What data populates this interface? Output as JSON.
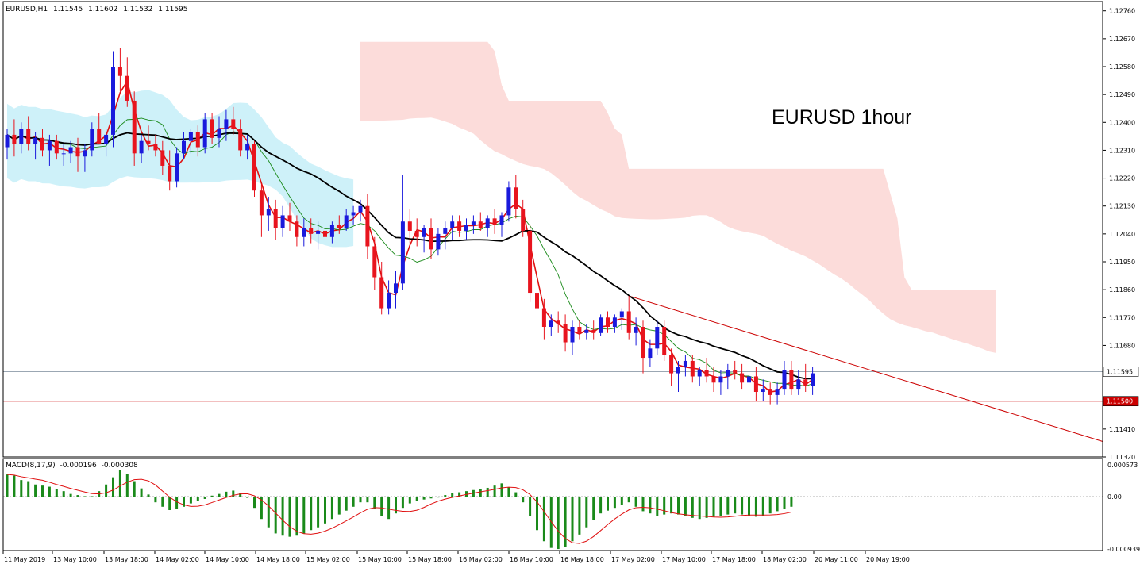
{
  "header": {
    "symbol": "EURUSD,H1",
    "open": "1.11545",
    "high": "1.11602",
    "low": "1.11532",
    "close": "1.11595"
  },
  "annotation": "EURUSD 1hour",
  "macd_header": {
    "name": "MACD(8,17,9)",
    "main": "-0.000196",
    "signal": "-0.000308"
  },
  "colors": {
    "bull": "#1a1adc",
    "bear": "#e8141e",
    "kumo_bull": "#c9f0f8",
    "kumo_bear": "#fbd6d4",
    "ma_fast": "#e01010",
    "ma_mid": "#1a8a1a",
    "ma_slow": "#000000",
    "macd_hist": "#1a8a1a",
    "macd_signal": "#e01010",
    "level": "#cc0000",
    "trend": "#cc0000"
  },
  "chart_data": [
    {
      "type": "candlestick",
      "symbol": "EURUSD",
      "timeframe": "H1",
      "title": "EURUSD 1hour",
      "ylim": [
        1.1132,
        1.1279
      ],
      "y_ticks": [
        "1.12760",
        "1.12670",
        "1.12580",
        "1.12490",
        "1.12400",
        "1.12310",
        "1.12220",
        "1.12130",
        "1.12040",
        "1.11950",
        "1.11860",
        "1.11770",
        "1.11680",
        "1.11410",
        "1.11320"
      ],
      "x_ticks": [
        "11 May 2019",
        "13 May 10:00",
        "13 May 18:00",
        "14 May 02:00",
        "14 May 10:00",
        "14 May 18:00",
        "15 May 02:00",
        "15 May 10:00",
        "15 May 18:00",
        "16 May 02:00",
        "16 May 10:00",
        "16 May 18:00",
        "17 May 02:00",
        "17 May 10:00",
        "17 May 18:00",
        "18 May 02:00",
        "20 May 11:00",
        "20 May 19:00"
      ],
      "current_price": {
        "value": 1.11595,
        "label": "1.11595"
      },
      "horizontal_level": {
        "value": 1.115,
        "label": "1.11500"
      },
      "trendline": {
        "from": {
          "bar": 88,
          "price": 1.1184
        },
        "to_price_at_right_edge": 1.1137
      },
      "candles": [
        {
          "o": 1.1232,
          "h": 1.1238,
          "l": 1.1228,
          "c": 1.1236
        },
        {
          "o": 1.1236,
          "h": 1.1241,
          "l": 1.1229,
          "c": 1.1233
        },
        {
          "o": 1.1233,
          "h": 1.124,
          "l": 1.123,
          "c": 1.1238
        },
        {
          "o": 1.1238,
          "h": 1.1242,
          "l": 1.1231,
          "c": 1.1233
        },
        {
          "o": 1.1233,
          "h": 1.1237,
          "l": 1.1228,
          "c": 1.1235
        },
        {
          "o": 1.1235,
          "h": 1.1238,
          "l": 1.1229,
          "c": 1.1231
        },
        {
          "o": 1.1231,
          "h": 1.1236,
          "l": 1.1226,
          "c": 1.1234
        },
        {
          "o": 1.1234,
          "h": 1.1236,
          "l": 1.1228,
          "c": 1.123
        },
        {
          "o": 1.123,
          "h": 1.1233,
          "l": 1.1226,
          "c": 1.123
        },
        {
          "o": 1.123,
          "h": 1.1234,
          "l": 1.1227,
          "c": 1.1232
        },
        {
          "o": 1.1232,
          "h": 1.1235,
          "l": 1.1224,
          "c": 1.1229
        },
        {
          "o": 1.1229,
          "h": 1.1233,
          "l": 1.1224,
          "c": 1.1231
        },
        {
          "o": 1.1231,
          "h": 1.124,
          "l": 1.1229,
          "c": 1.1238
        },
        {
          "o": 1.1238,
          "h": 1.1243,
          "l": 1.1233,
          "c": 1.1233
        },
        {
          "o": 1.1233,
          "h": 1.1238,
          "l": 1.1229,
          "c": 1.1236
        },
        {
          "o": 1.1236,
          "h": 1.1263,
          "l": 1.1232,
          "c": 1.1258
        },
        {
          "o": 1.1258,
          "h": 1.1264,
          "l": 1.125,
          "c": 1.1255
        },
        {
          "o": 1.1255,
          "h": 1.1261,
          "l": 1.1245,
          "c": 1.1247
        },
        {
          "o": 1.1247,
          "h": 1.125,
          "l": 1.1226,
          "c": 1.123
        },
        {
          "o": 1.123,
          "h": 1.1236,
          "l": 1.1227,
          "c": 1.1234
        },
        {
          "o": 1.1234,
          "h": 1.1239,
          "l": 1.1231,
          "c": 1.1233
        },
        {
          "o": 1.1233,
          "h": 1.1236,
          "l": 1.1229,
          "c": 1.1231
        },
        {
          "o": 1.1231,
          "h": 1.1234,
          "l": 1.1223,
          "c": 1.1226
        },
        {
          "o": 1.1226,
          "h": 1.1231,
          "l": 1.1218,
          "c": 1.1221
        },
        {
          "o": 1.1221,
          "h": 1.1232,
          "l": 1.1219,
          "c": 1.123
        },
        {
          "o": 1.123,
          "h": 1.1237,
          "l": 1.1228,
          "c": 1.1234
        },
        {
          "o": 1.1234,
          "h": 1.1238,
          "l": 1.123,
          "c": 1.1237
        },
        {
          "o": 1.1237,
          "h": 1.1239,
          "l": 1.1229,
          "c": 1.1232
        },
        {
          "o": 1.1232,
          "h": 1.1243,
          "l": 1.123,
          "c": 1.1241
        },
        {
          "o": 1.1241,
          "h": 1.1243,
          "l": 1.1233,
          "c": 1.1235
        },
        {
          "o": 1.1235,
          "h": 1.1242,
          "l": 1.1232,
          "c": 1.1238
        },
        {
          "o": 1.1238,
          "h": 1.1244,
          "l": 1.1234,
          "c": 1.1241
        },
        {
          "o": 1.1241,
          "h": 1.1245,
          "l": 1.1236,
          "c": 1.1238
        },
        {
          "o": 1.1238,
          "h": 1.1241,
          "l": 1.1229,
          "c": 1.1231
        },
        {
          "o": 1.1231,
          "h": 1.1236,
          "l": 1.1228,
          "c": 1.1233
        },
        {
          "o": 1.1233,
          "h": 1.1234,
          "l": 1.1216,
          "c": 1.1218
        },
        {
          "o": 1.1218,
          "h": 1.122,
          "l": 1.1203,
          "c": 1.121
        },
        {
          "o": 1.121,
          "h": 1.1216,
          "l": 1.1205,
          "c": 1.1212
        },
        {
          "o": 1.1212,
          "h": 1.1215,
          "l": 1.1202,
          "c": 1.1206
        },
        {
          "o": 1.1206,
          "h": 1.1213,
          "l": 1.1203,
          "c": 1.121
        },
        {
          "o": 1.121,
          "h": 1.1214,
          "l": 1.1205,
          "c": 1.1208
        },
        {
          "o": 1.1208,
          "h": 1.121,
          "l": 1.12,
          "c": 1.1203
        },
        {
          "o": 1.1203,
          "h": 1.1209,
          "l": 1.12,
          "c": 1.1206
        },
        {
          "o": 1.1206,
          "h": 1.1209,
          "l": 1.1201,
          "c": 1.1204
        },
        {
          "o": 1.1204,
          "h": 1.1208,
          "l": 1.1199,
          "c": 1.1205
        },
        {
          "o": 1.1205,
          "h": 1.1208,
          "l": 1.1201,
          "c": 1.1203
        },
        {
          "o": 1.1203,
          "h": 1.1208,
          "l": 1.1201,
          "c": 1.1207
        },
        {
          "o": 1.1207,
          "h": 1.121,
          "l": 1.1204,
          "c": 1.1206
        },
        {
          "o": 1.1206,
          "h": 1.1212,
          "l": 1.1205,
          "c": 1.121
        },
        {
          "o": 1.121,
          "h": 1.1213,
          "l": 1.1207,
          "c": 1.1211
        },
        {
          "o": 1.1211,
          "h": 1.1215,
          "l": 1.1208,
          "c": 1.1213
        },
        {
          "o": 1.1213,
          "h": 1.1217,
          "l": 1.1196,
          "c": 1.12
        },
        {
          "o": 1.12,
          "h": 1.1203,
          "l": 1.1186,
          "c": 1.119
        },
        {
          "o": 1.119,
          "h": 1.1195,
          "l": 1.1178,
          "c": 1.118
        },
        {
          "o": 1.118,
          "h": 1.1189,
          "l": 1.1178,
          "c": 1.1185
        },
        {
          "o": 1.1185,
          "h": 1.1192,
          "l": 1.118,
          "c": 1.1188
        },
        {
          "o": 1.1188,
          "h": 1.1223,
          "l": 1.1186,
          "c": 1.1208
        },
        {
          "o": 1.1208,
          "h": 1.1212,
          "l": 1.1201,
          "c": 1.1205
        },
        {
          "o": 1.1205,
          "h": 1.1209,
          "l": 1.12,
          "c": 1.1203
        },
        {
          "o": 1.1203,
          "h": 1.1207,
          "l": 1.1198,
          "c": 1.1206
        },
        {
          "o": 1.1206,
          "h": 1.1209,
          "l": 1.1196,
          "c": 1.1199
        },
        {
          "o": 1.1199,
          "h": 1.1206,
          "l": 1.1197,
          "c": 1.1204
        },
        {
          "o": 1.1204,
          "h": 1.1208,
          "l": 1.1199,
          "c": 1.1206
        },
        {
          "o": 1.1206,
          "h": 1.121,
          "l": 1.1202,
          "c": 1.1208
        },
        {
          "o": 1.1208,
          "h": 1.121,
          "l": 1.1203,
          "c": 1.1205
        },
        {
          "o": 1.1205,
          "h": 1.1209,
          "l": 1.1202,
          "c": 1.1207
        },
        {
          "o": 1.1207,
          "h": 1.121,
          "l": 1.1204,
          "c": 1.1208
        },
        {
          "o": 1.1208,
          "h": 1.1211,
          "l": 1.1205,
          "c": 1.1206
        },
        {
          "o": 1.1206,
          "h": 1.121,
          "l": 1.1203,
          "c": 1.1209
        },
        {
          "o": 1.1209,
          "h": 1.1212,
          "l": 1.1204,
          "c": 1.1207
        },
        {
          "o": 1.1207,
          "h": 1.1211,
          "l": 1.1203,
          "c": 1.121
        },
        {
          "o": 1.121,
          "h": 1.1221,
          "l": 1.1208,
          "c": 1.1219
        },
        {
          "o": 1.1219,
          "h": 1.1223,
          "l": 1.1209,
          "c": 1.1212
        },
        {
          "o": 1.1212,
          "h": 1.1215,
          "l": 1.1203,
          "c": 1.1205
        },
        {
          "o": 1.1205,
          "h": 1.1207,
          "l": 1.1182,
          "c": 1.1185
        },
        {
          "o": 1.1185,
          "h": 1.1188,
          "l": 1.1175,
          "c": 1.118
        },
        {
          "o": 1.118,
          "h": 1.1183,
          "l": 1.117,
          "c": 1.1174
        },
        {
          "o": 1.1174,
          "h": 1.1178,
          "l": 1.1171,
          "c": 1.1176
        },
        {
          "o": 1.1176,
          "h": 1.1179,
          "l": 1.1172,
          "c": 1.1175
        },
        {
          "o": 1.1175,
          "h": 1.1178,
          "l": 1.1166,
          "c": 1.1169
        },
        {
          "o": 1.1169,
          "h": 1.1176,
          "l": 1.1165,
          "c": 1.1174
        },
        {
          "o": 1.1174,
          "h": 1.1176,
          "l": 1.117,
          "c": 1.1172
        },
        {
          "o": 1.1172,
          "h": 1.1175,
          "l": 1.117,
          "c": 1.1173
        },
        {
          "o": 1.1173,
          "h": 1.1176,
          "l": 1.117,
          "c": 1.1172
        },
        {
          "o": 1.1172,
          "h": 1.1178,
          "l": 1.1171,
          "c": 1.1177
        },
        {
          "o": 1.1177,
          "h": 1.1179,
          "l": 1.1172,
          "c": 1.1174
        },
        {
          "o": 1.1174,
          "h": 1.1178,
          "l": 1.1172,
          "c": 1.1177
        },
        {
          "o": 1.1177,
          "h": 1.118,
          "l": 1.1173,
          "c": 1.1179
        },
        {
          "o": 1.1179,
          "h": 1.1184,
          "l": 1.117,
          "c": 1.1172
        },
        {
          "o": 1.1172,
          "h": 1.1177,
          "l": 1.1168,
          "c": 1.1174
        },
        {
          "o": 1.1174,
          "h": 1.1176,
          "l": 1.1159,
          "c": 1.1164
        },
        {
          "o": 1.1164,
          "h": 1.117,
          "l": 1.1161,
          "c": 1.1167
        },
        {
          "o": 1.1167,
          "h": 1.1176,
          "l": 1.1165,
          "c": 1.1174
        },
        {
          "o": 1.1174,
          "h": 1.1176,
          "l": 1.1163,
          "c": 1.1165
        },
        {
          "o": 1.1165,
          "h": 1.1167,
          "l": 1.1155,
          "c": 1.1159
        },
        {
          "o": 1.1159,
          "h": 1.1163,
          "l": 1.1153,
          "c": 1.1161
        },
        {
          "o": 1.1161,
          "h": 1.1165,
          "l": 1.1158,
          "c": 1.1163
        },
        {
          "o": 1.1163,
          "h": 1.1165,
          "l": 1.1156,
          "c": 1.1158
        },
        {
          "o": 1.1158,
          "h": 1.1161,
          "l": 1.1155,
          "c": 1.116
        },
        {
          "o": 1.116,
          "h": 1.1164,
          "l": 1.1156,
          "c": 1.1158
        },
        {
          "o": 1.1158,
          "h": 1.1161,
          "l": 1.1153,
          "c": 1.1156
        },
        {
          "o": 1.1156,
          "h": 1.116,
          "l": 1.1152,
          "c": 1.1158
        },
        {
          "o": 1.1158,
          "h": 1.1162,
          "l": 1.1154,
          "c": 1.116
        },
        {
          "o": 1.116,
          "h": 1.1163,
          "l": 1.1157,
          "c": 1.1159
        },
        {
          "o": 1.1159,
          "h": 1.1162,
          "l": 1.1154,
          "c": 1.1156
        },
        {
          "o": 1.1156,
          "h": 1.116,
          "l": 1.1154,
          "c": 1.1158
        },
        {
          "o": 1.1158,
          "h": 1.1161,
          "l": 1.115,
          "c": 1.1153
        },
        {
          "o": 1.1153,
          "h": 1.1157,
          "l": 1.115,
          "c": 1.1154
        },
        {
          "o": 1.1154,
          "h": 1.1156,
          "l": 1.1149,
          "c": 1.1152
        },
        {
          "o": 1.1152,
          "h": 1.1156,
          "l": 1.1149,
          "c": 1.1154
        },
        {
          "o": 1.1154,
          "h": 1.1163,
          "l": 1.1152,
          "c": 1.116
        },
        {
          "o": 1.116,
          "h": 1.1163,
          "l": 1.1152,
          "c": 1.1154
        },
        {
          "o": 1.1154,
          "h": 1.116,
          "l": 1.1152,
          "c": 1.1157
        },
        {
          "o": 1.1157,
          "h": 1.1162,
          "l": 1.1153,
          "c": 1.1155
        },
        {
          "o": 1.1155,
          "h": 1.1161,
          "l": 1.1152,
          "c": 1.1159
        }
      ]
    },
    {
      "type": "bar",
      "name": "MACD(8,17,9)",
      "ylim": [
        -0.000939,
        0.000573
      ],
      "y_ticks": [
        "0.000573",
        "0.00",
        "-0.000939"
      ],
      "main": -0.000196,
      "signal": -0.000308,
      "histogram": [
        0.0004,
        0.00038,
        0.0003,
        0.00028,
        0.00022,
        0.0002,
        0.00018,
        0.00014,
        0.0001,
        5e-05,
        3e-05,
        1e-05,
        1e-05,
        0.0001,
        0.00022,
        0.00035,
        0.00048,
        0.00041,
        0.00028,
        0.00015,
        4e-05,
        -0.0001,
        -0.00018,
        -0.00024,
        -0.00022,
        -0.00018,
        -0.00012,
        -8e-05,
        -4e-05,
        2e-05,
        5e-05,
        9e-05,
        0.00011,
        7e-05,
        -2e-05,
        -0.0002,
        -0.0004,
        -0.00055,
        -0.00066,
        -0.0007,
        -0.00072,
        -0.0007,
        -0.00066,
        -0.0006,
        -0.00055,
        -0.00048,
        -0.0004,
        -0.00032,
        -0.00025,
        -0.00018,
        -0.0001,
        -0.0001,
        -0.00022,
        -0.00035,
        -0.0004,
        -0.0003,
        -0.0002,
        -0.00012,
        -8e-05,
        -5e-05,
        -3e-05,
        0.0,
        3e-05,
        6e-05,
        8e-05,
        0.0001,
        0.00012,
        0.00014,
        0.00016,
        0.0002,
        0.00024,
        0.00017,
        8e-05,
        -0.0001,
        -0.00035,
        -0.0006,
        -0.0008,
        -0.00092,
        -0.00094,
        -0.0009,
        -0.0008,
        -0.00068,
        -0.00055,
        -0.00042,
        -0.0003,
        -0.00025,
        -0.0002,
        -0.00015,
        -0.0001,
        -0.00018,
        -0.00026,
        -0.0003,
        -0.00035,
        -0.00032,
        -0.0003,
        -0.00032,
        -0.00035,
        -0.00038,
        -0.0004,
        -0.00038,
        -0.00036,
        -0.00034,
        -0.00032,
        -0.0003,
        -0.00032,
        -0.00034,
        -0.00036,
        -0.00034,
        -0.0003,
        -0.00026,
        -0.00022,
        -0.00018
      ]
    }
  ]
}
